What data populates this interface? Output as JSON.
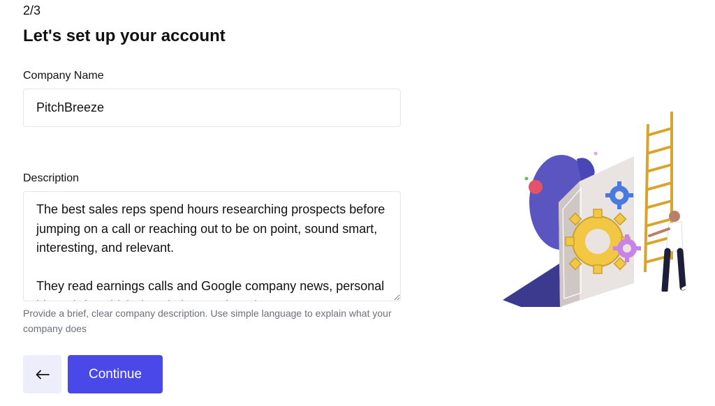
{
  "step": "2/3",
  "title": "Let's set up your account",
  "company": {
    "label": "Company Name",
    "value": "PitchBreeze"
  },
  "description": {
    "label": "Description",
    "value": "The best sales reps spend hours researching prospects before jumping on a call or reaching out to be on point, sound smart, interesting, and relevant.\n\nThey read earnings calls and Google company news, personal blogs, infer which descriptions and product",
    "helper": "Provide a brief, clear company description. Use simple language to explain what your company does"
  },
  "actions": {
    "back_icon": "arrow-left-icon",
    "continue_label": "Continue"
  },
  "colors": {
    "accent": "#4b48ea",
    "back_bg": "#ededfb",
    "helper_text": "#6b6f7a"
  }
}
